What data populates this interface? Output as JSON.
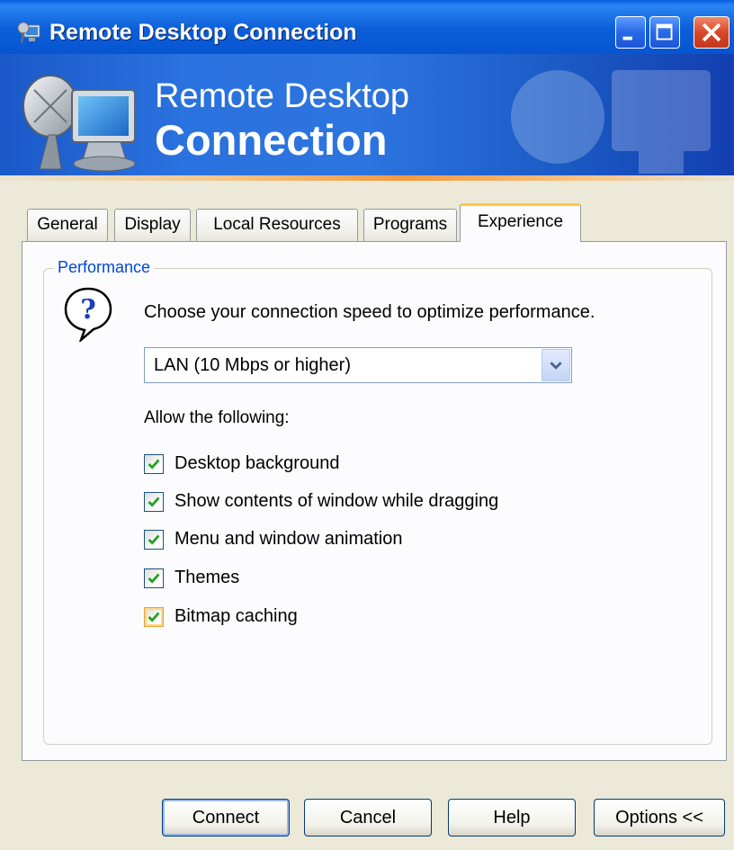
{
  "window": {
    "title": "Remote Desktop Connection"
  },
  "banner": {
    "line1": "Remote Desktop",
    "line2": "Connection"
  },
  "tabs": [
    {
      "label": "General",
      "active": false
    },
    {
      "label": "Display",
      "active": false
    },
    {
      "label": "Local Resources",
      "active": false
    },
    {
      "label": "Programs",
      "active": false
    },
    {
      "label": "Experience",
      "active": true
    }
  ],
  "performance": {
    "group_label": "Performance",
    "speed_prompt": "Choose your connection speed to optimize performance.",
    "speed_selected": "LAN (10 Mbps or higher)",
    "allow_label": "Allow the following:",
    "options": [
      {
        "label": "Desktop background",
        "checked": true
      },
      {
        "label": "Show contents of window while dragging",
        "checked": true
      },
      {
        "label": "Menu and window animation",
        "checked": true
      },
      {
        "label": "Themes",
        "checked": true
      },
      {
        "label": "Bitmap caching",
        "checked": true
      }
    ]
  },
  "buttons": {
    "connect": "Connect",
    "cancel": "Cancel",
    "help": "Help",
    "options": "Options <<"
  },
  "colors": {
    "titlebar": "#0453cf",
    "group_label": "#0046d5",
    "active_tab_accent": "#ffc83c",
    "check_mark": "#21a121"
  }
}
